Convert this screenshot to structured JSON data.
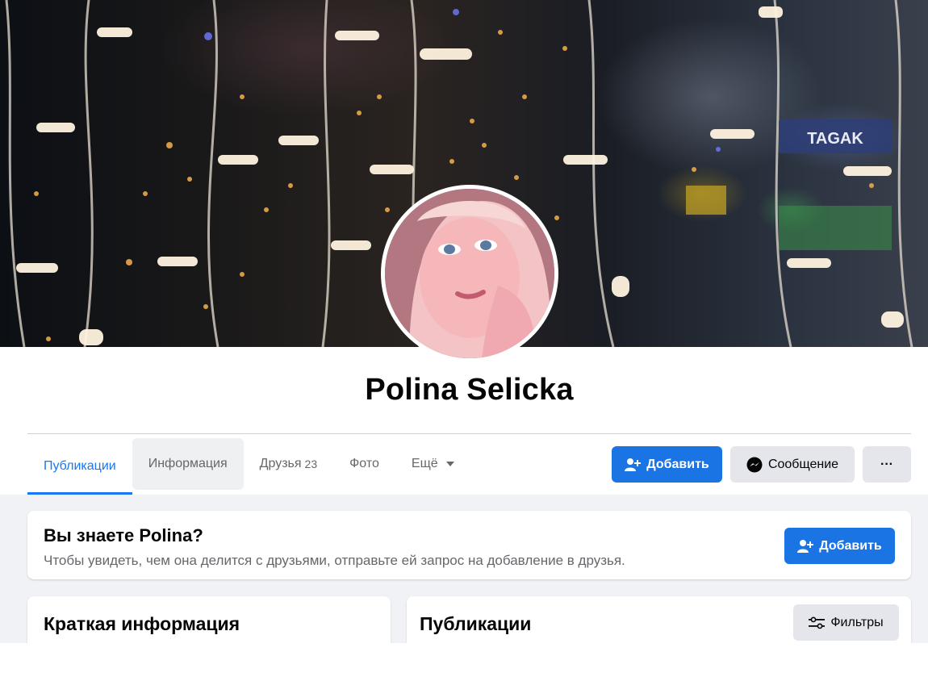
{
  "profile": {
    "name": "Polina Selicka"
  },
  "tabs": [
    {
      "label": "Публикации"
    },
    {
      "label": "Информация"
    },
    {
      "label": "Друзья",
      "count": "23"
    },
    {
      "label": "Фото"
    },
    {
      "label": "Ещё"
    }
  ],
  "actions": {
    "add_label": "Добавить",
    "message_label": "Сообщение",
    "more_label": "···"
  },
  "know_card": {
    "title": "Вы знаете Polina?",
    "text": "Чтобы увидеть, чем она делится с друзьями, отправьте ей запрос на добавление в друзья.",
    "add_label": "Добавить"
  },
  "info_card": {
    "title": "Краткая информация"
  },
  "posts_card": {
    "title": "Публикации",
    "filters_label": "Фильтры"
  },
  "colors": {
    "accent": "#1877f2",
    "button_primary": "#1b74e4",
    "button_secondary": "#e4e6eb",
    "background": "#f0f2f5",
    "text_secondary": "#65676b"
  },
  "icons": {
    "add_friend": "add-friend-icon",
    "messenger": "messenger-icon",
    "more": "more-dots-icon",
    "caret": "caret-down-icon",
    "filters": "filters-icon"
  }
}
